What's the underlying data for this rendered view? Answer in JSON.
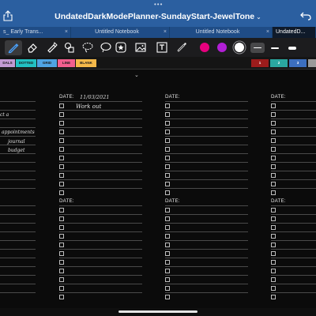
{
  "titlebar": {
    "title": "UndatedDarkModePlanner-SundayStart-JewelTone",
    "title_chevron": "⌄",
    "dots": "•••"
  },
  "tabs": [
    {
      "label": "s_ Early Trans...",
      "active": false
    },
    {
      "label": "Untitled Notebook",
      "active": false
    },
    {
      "label": "Untitled Notebook",
      "active": false
    },
    {
      "label": "UndatedD...",
      "active": true
    }
  ],
  "tab_close": "×",
  "toolbar": {
    "colors": [
      "#e6007e",
      "#b21fd6",
      "#ffffff"
    ],
    "selected_color": "#ffffff",
    "line_widths": [
      "thin",
      "medium",
      "thick"
    ],
    "selected_line_width": "thin"
  },
  "top_strip": {
    "left_tabs": [
      {
        "label": "DALS",
        "color": "#c39bd3"
      },
      {
        "label": "DOTTED",
        "color": "#22c1c3"
      },
      {
        "label": "GRID",
        "color": "#4fa3e3"
      },
      {
        "label": "LINE",
        "color": "#f25f8e"
      },
      {
        "label": "BLANK",
        "color": "#f5b94a"
      }
    ],
    "right_tabs": [
      {
        "label": "1",
        "color": "#9c1c1c"
      },
      {
        "label": "2",
        "color": "#2aa7a0"
      },
      {
        "label": "3",
        "color": "#3c6fbf"
      },
      {
        "label": "",
        "color": "#9a9a9a"
      }
    ]
  },
  "planner": {
    "date_label": "DATE:",
    "entries": {
      "top_2_date": "11/03/2021",
      "top_2_item_1": "Work out"
    },
    "left_notes": [
      "ct a",
      "appointments",
      "journal",
      "budget"
    ]
  },
  "cursor_mark": "⌄"
}
